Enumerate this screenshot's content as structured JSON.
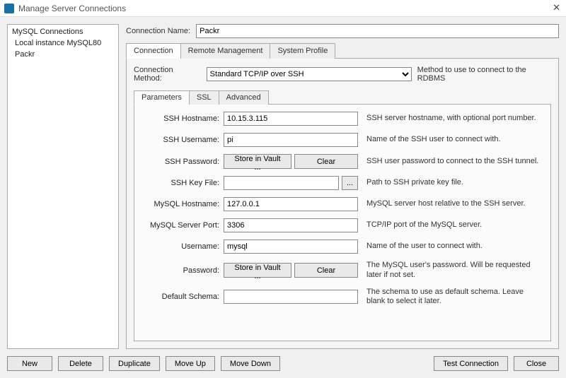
{
  "titlebar": {
    "title": "Manage Server Connections",
    "close_glyph": "✕"
  },
  "sidebar": {
    "header": "MySQL Connections",
    "items": [
      {
        "label": "Local instance MySQL80"
      },
      {
        "label": "Packr"
      }
    ]
  },
  "connection_name": {
    "label": "Connection Name:",
    "value": "Packr"
  },
  "tabs": {
    "connection": "Connection",
    "remote": "Remote Management",
    "system": "System Profile"
  },
  "method": {
    "label": "Connection Method:",
    "value": "Standard TCP/IP over SSH",
    "desc": "Method to use to connect to the RDBMS"
  },
  "inner_tabs": {
    "parameters": "Parameters",
    "ssl": "SSL",
    "advanced": "Advanced"
  },
  "fields": {
    "ssh_hostname": {
      "label": "SSH Hostname:",
      "value": "10.15.3.115",
      "hint": "SSH server hostname, with  optional port number."
    },
    "ssh_username": {
      "label": "SSH Username:",
      "value": "pi",
      "hint": "Name of the SSH user to connect with."
    },
    "ssh_password": {
      "label": "SSH Password:",
      "store": "Store in Vault ...",
      "clear": "Clear",
      "hint": "SSH user password to connect to the SSH tunnel."
    },
    "ssh_keyfile": {
      "label": "SSH Key File:",
      "value": "",
      "browse": "...",
      "hint": "Path to SSH private key file."
    },
    "mysql_hostname": {
      "label": "MySQL Hostname:",
      "value": "127.0.0.1",
      "hint": "MySQL server host relative to the SSH server."
    },
    "mysql_port": {
      "label": "MySQL Server Port:",
      "value": "3306",
      "hint": "TCP/IP port of the MySQL server."
    },
    "username": {
      "label": "Username:",
      "value": "mysql",
      "hint": "Name of the user to connect with."
    },
    "password": {
      "label": "Password:",
      "store": "Store in Vault ...",
      "clear": "Clear",
      "hint": "The MySQL user's password. Will be requested later if not set."
    },
    "default_schema": {
      "label": "Default Schema:",
      "value": "",
      "hint": "The schema to use as default schema. Leave blank to select it later."
    }
  },
  "footer": {
    "new": "New",
    "delete": "Delete",
    "duplicate": "Duplicate",
    "moveup": "Move Up",
    "movedown": "Move Down",
    "test": "Test Connection",
    "close": "Close"
  }
}
